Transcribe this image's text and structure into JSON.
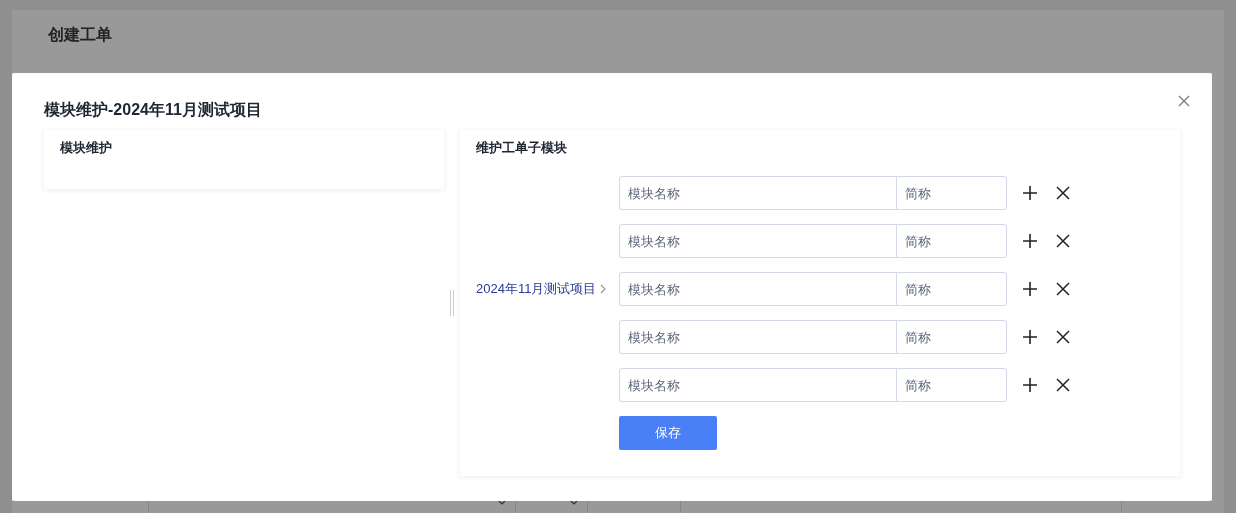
{
  "page": {
    "title": "创建工单",
    "form_fields": [
      {
        "kind": "select",
        "addon": true
      },
      {
        "kind": "text"
      }
    ]
  },
  "modal": {
    "title": "模块维护-2024年11月测试项目",
    "left_panel": {
      "title": "模块维护"
    },
    "right_panel": {
      "title": "维护工单子模块",
      "project": "2024年11月测试项目",
      "rows": [
        {
          "name_placeholder": "模块名称",
          "abbr_placeholder": "简称"
        },
        {
          "name_placeholder": "模块名称",
          "abbr_placeholder": "简称"
        },
        {
          "name_placeholder": "模块名称",
          "abbr_placeholder": "简称"
        },
        {
          "name_placeholder": "模块名称",
          "abbr_placeholder": "简称"
        },
        {
          "name_placeholder": "模块名称",
          "abbr_placeholder": "简称"
        }
      ],
      "save_button": "保存"
    }
  }
}
